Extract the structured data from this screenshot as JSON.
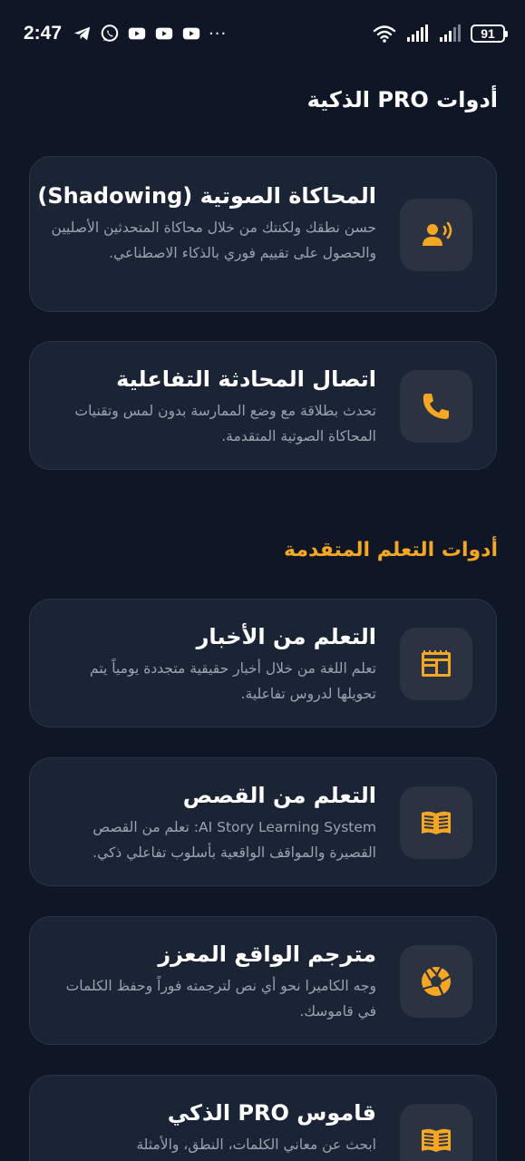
{
  "status_bar": {
    "time": "2:47",
    "battery": "91",
    "icons": [
      "telegram-icon",
      "whatsapp-icon",
      "youtube-icon",
      "youtube-icon",
      "youtube-icon",
      "more-dots-icon",
      "wifi-icon",
      "signal-icon",
      "signal-icon",
      "battery-icon"
    ],
    "more": "···"
  },
  "sections": {
    "pro_tools_title": "أدوات PRO الذكية",
    "advanced_title": "أدوات التعلم المتقدمة"
  },
  "cards": [
    {
      "title": "المحاكاة الصوتية (Shadowing)",
      "description": "حسن نطقك ولكنتك من خلال محاكاة المتحدثين الأصليين والحصول على تقييم فوري بالذكاء الاصطناعي.",
      "icon": "voice-speaker-icon"
    },
    {
      "title": "اتصال المحادثة التفاعلية",
      "description": "تحدث بطلاقة مع وضع الممارسة بدون لمس وتقنيات المحاكاة الصوتية المتقدمة.",
      "icon": "phone-icon"
    },
    {
      "title": "التعلم من الأخبار",
      "description": "تعلم اللغة من خلال أخبار حقيقية متجددة يومياً يتم تحويلها لدروس تفاعلية.",
      "icon": "newspaper-icon"
    },
    {
      "title": "التعلم من القصص",
      "description": "AI Story Learning System: تعلم من القصص القصيرة والمواقف الواقعية بأسلوب تفاعلي ذكي.",
      "icon": "book-icon"
    },
    {
      "title": "مترجم الواقع المعزز",
      "description": "وجه الكاميرا نحو أي نص لترجمته فوراً وحفظ الكلمات في قاموسك.",
      "icon": "camera-aperture-icon"
    },
    {
      "title": "قاموس PRO الذكي",
      "description": "ابحث عن معاني الكلمات، النطق، والأمثلة",
      "icon": "book-icon"
    }
  ],
  "colors": {
    "background": "#0f1726",
    "card": "#1b2434",
    "icon_box": "#2b3343",
    "accent": "#f5a623",
    "muted_text": "#9aa3b2"
  }
}
